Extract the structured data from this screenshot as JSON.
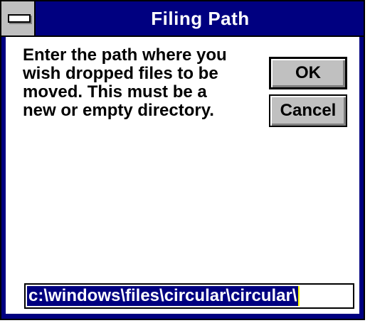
{
  "window": {
    "title": "Filing Path",
    "system_menu_icon": "system-menu-bar-icon"
  },
  "message": {
    "lines": [
      "Enter the path where you",
      "wish dropped files to be",
      "moved. This must be a",
      "new or empty directory."
    ]
  },
  "buttons": {
    "ok_label": "OK",
    "cancel_label": "Cancel"
  },
  "path_field": {
    "value": "c:\\windows\\files\\circular\\circular\\"
  },
  "colors": {
    "title_bar": "#000080",
    "selection": "#000080",
    "button_face": "#c0c0c0",
    "caret": "#ffff00"
  }
}
